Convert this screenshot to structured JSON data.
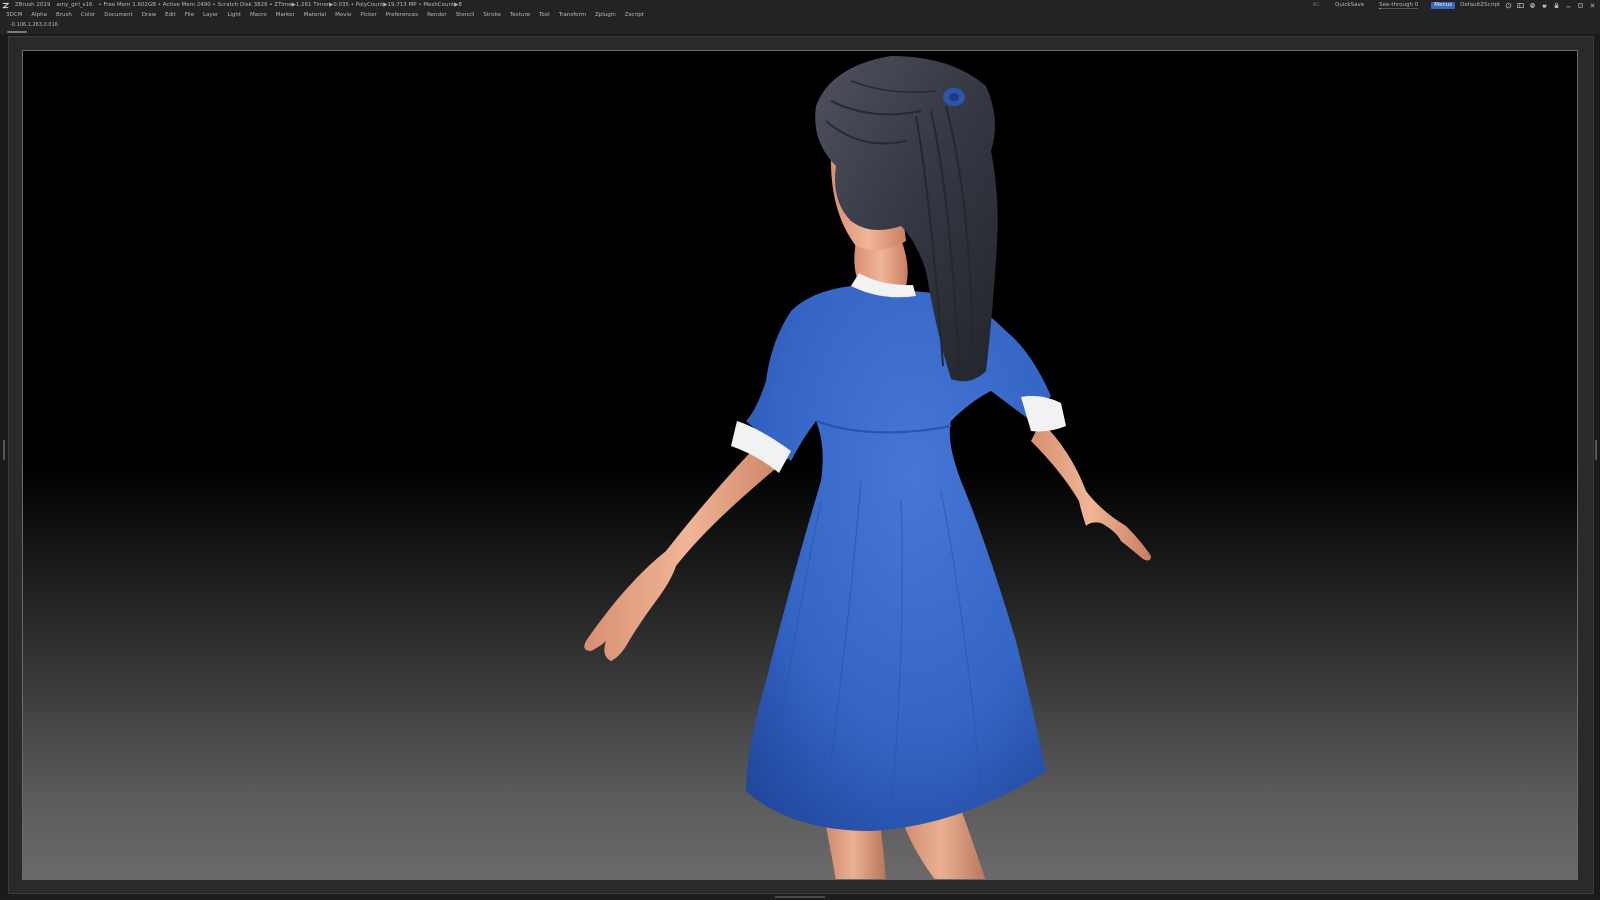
{
  "titlebar": {
    "app": "ZBrush 2019",
    "file": "amy_girl_s16",
    "stats": "• Free Mem 1.602GB • Active Mem 2490 • Scratch Disk 3826 • ZTime▶1.261 Timer▶0.035 • PolyCount▶19.713 MP • MeshCount▶8",
    "ac": "AC",
    "quicksave": "QuickSave",
    "seethrough_label": "See-through",
    "seethrough_value": "0",
    "seethrough_level": 0,
    "menus_chip": "Menus",
    "script": "DefaultZScript",
    "icons": [
      "help-icon",
      "ui-layout-icon",
      "palette-icon",
      "store-icon",
      "lock-icon",
      "minimize-icon",
      "maximize-icon",
      "close-icon"
    ]
  },
  "menubar": {
    "items": [
      "3DCM",
      "Alpha",
      "Brush",
      "Color",
      "Document",
      "Draw",
      "Edit",
      "File",
      "Layer",
      "Light",
      "Macro",
      "Marker",
      "Material",
      "Movie",
      "Picker",
      "Preferences",
      "Render",
      "Stencil",
      "Stroke",
      "Texture",
      "Tool",
      "Transform",
      "Zplugin",
      "Zscript"
    ]
  },
  "coordbar": {
    "coords": "-0.106,1.263,0.016"
  },
  "colors": {
    "dress": "#3464c4",
    "hair": "#3a3d47",
    "skin": "#e9a98a",
    "collar": "#f2f2f2",
    "hairtie": "#2d55b0"
  }
}
